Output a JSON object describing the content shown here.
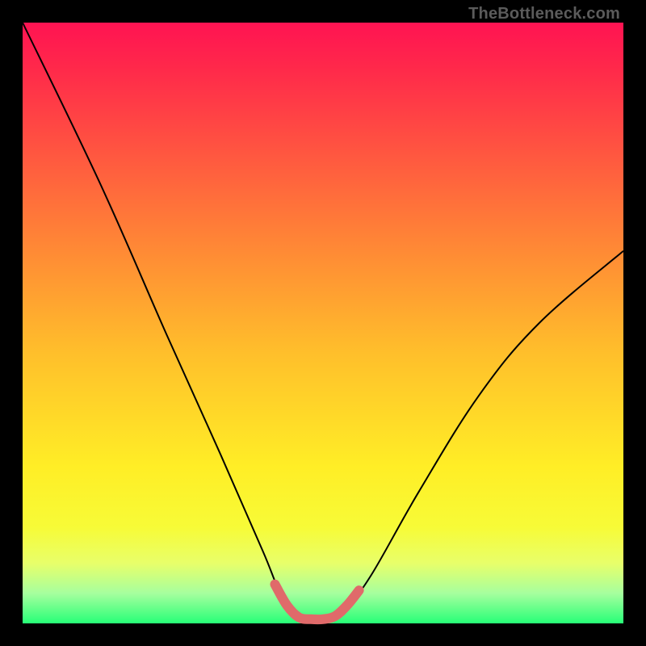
{
  "watermark": "TheBottleneck.com",
  "chart_data": {
    "type": "line",
    "title": "",
    "xlabel": "",
    "ylabel": "",
    "xlim": [
      0,
      100
    ],
    "ylim": [
      0,
      100
    ],
    "grid": false,
    "series": [
      {
        "name": "bottleneck-curve",
        "x": [
          0,
          13,
          24,
          33,
          40,
          43,
          46.5,
          50,
          54,
          58,
          66,
          76,
          86,
          100
        ],
        "values": [
          100,
          73,
          48,
          28,
          12,
          5,
          1,
          1,
          3,
          8,
          22,
          38,
          50,
          62
        ],
        "stroke": "#000000",
        "stroke_width": 2
      },
      {
        "name": "optimum-highlight",
        "x": [
          42,
          44,
          46,
          48,
          50,
          52,
          54,
          56
        ],
        "values": [
          6.5,
          3,
          1,
          0.7,
          0.7,
          1.2,
          3,
          5.5
        ],
        "stroke": "#e06a6a",
        "stroke_width": 12,
        "cap": "round"
      }
    ],
    "annotations": []
  }
}
